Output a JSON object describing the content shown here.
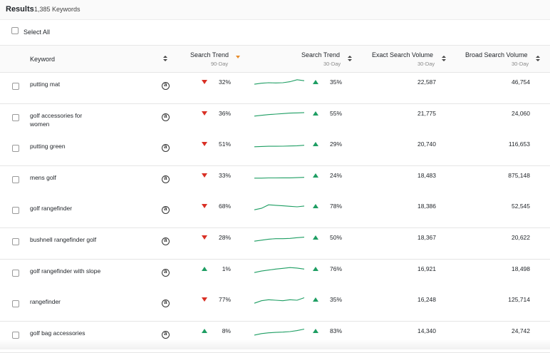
{
  "results": {
    "title": "Results",
    "count": "1,385 Keywords"
  },
  "select_all": {
    "label": "Select All"
  },
  "columns": {
    "keyword": "Keyword",
    "trend90": {
      "label": "Search Trend",
      "sub": "90-Day"
    },
    "trend30": {
      "label": "Search Trend",
      "sub": "30-Day"
    },
    "exact": {
      "label": "Exact Search Volume",
      "sub": "30-Day"
    },
    "broad": {
      "label": "Broad Search Volume",
      "sub": "30-Day"
    }
  },
  "colors": {
    "down": "#d93025",
    "up": "#1e9e63",
    "sort_active": "#e88c2a"
  },
  "icons": {
    "amazon": "amazon-icon"
  },
  "rows": [
    {
      "keyword": "putting mat",
      "trend90_dir": "down",
      "trend90_pct": "32%",
      "trend30_dir": "up",
      "trend30_pct": "35%",
      "exact": "22,587",
      "broad": "46,754",
      "spark": [
        0.35,
        0.45,
        0.5,
        0.48,
        0.5,
        0.6,
        0.8,
        0.7
      ]
    },
    {
      "keyword": "golf accessories for women",
      "trend90_dir": "down",
      "trend90_pct": "36%",
      "trend30_dir": "up",
      "trend30_pct": "55%",
      "exact": "21,775",
      "broad": "24,060",
      "spark": [
        0.3,
        0.38,
        0.45,
        0.5,
        0.55,
        0.6,
        0.62,
        0.65
      ]
    },
    {
      "keyword": "putting green",
      "trend90_dir": "down",
      "trend90_pct": "51%",
      "trend30_dir": "up",
      "trend30_pct": "29%",
      "exact": "20,740",
      "broad": "116,653",
      "spark": [
        0.3,
        0.33,
        0.35,
        0.35,
        0.36,
        0.38,
        0.4,
        0.45
      ]
    },
    {
      "keyword": "mens golf",
      "trend90_dir": "down",
      "trend90_pct": "33%",
      "trend30_dir": "up",
      "trend30_pct": "24%",
      "exact": "18,483",
      "broad": "875,148",
      "spark": [
        0.3,
        0.3,
        0.32,
        0.32,
        0.33,
        0.33,
        0.35,
        0.38
      ]
    },
    {
      "keyword": "golf rangefinder",
      "trend90_dir": "down",
      "trend90_pct": "68%",
      "trend30_dir": "up",
      "trend30_pct": "78%",
      "exact": "18,386",
      "broad": "52,545",
      "spark": [
        0.2,
        0.35,
        0.7,
        0.65,
        0.6,
        0.55,
        0.5,
        0.58
      ]
    },
    {
      "keyword": "bushnell rangefinder golf",
      "trend90_dir": "down",
      "trend90_pct": "28%",
      "trend30_dir": "up",
      "trend30_pct": "50%",
      "exact": "18,367",
      "broad": "20,622",
      "spark": [
        0.2,
        0.3,
        0.4,
        0.45,
        0.45,
        0.48,
        0.55,
        0.6
      ]
    },
    {
      "keyword": "golf rangefinder with slope",
      "trend90_dir": "up",
      "trend90_pct": "1%",
      "trend30_dir": "up",
      "trend30_pct": "76%",
      "exact": "16,921",
      "broad": "18,498",
      "spark": [
        0.2,
        0.35,
        0.45,
        0.55,
        0.62,
        0.7,
        0.65,
        0.55
      ]
    },
    {
      "keyword": "rangefinder",
      "trend90_dir": "down",
      "trend90_pct": "77%",
      "trend30_dir": "up",
      "trend30_pct": "35%",
      "exact": "16,248",
      "broad": "125,714",
      "spark": [
        0.2,
        0.45,
        0.55,
        0.5,
        0.45,
        0.55,
        0.5,
        0.75
      ]
    },
    {
      "keyword": "golf bag accessories",
      "trend90_dir": "up",
      "trend90_pct": "8%",
      "trend30_dir": "up",
      "trend30_pct": "83%",
      "exact": "14,340",
      "broad": "24,742",
      "spark": [
        0.15,
        0.3,
        0.38,
        0.42,
        0.45,
        0.5,
        0.6,
        0.75
      ]
    }
  ]
}
